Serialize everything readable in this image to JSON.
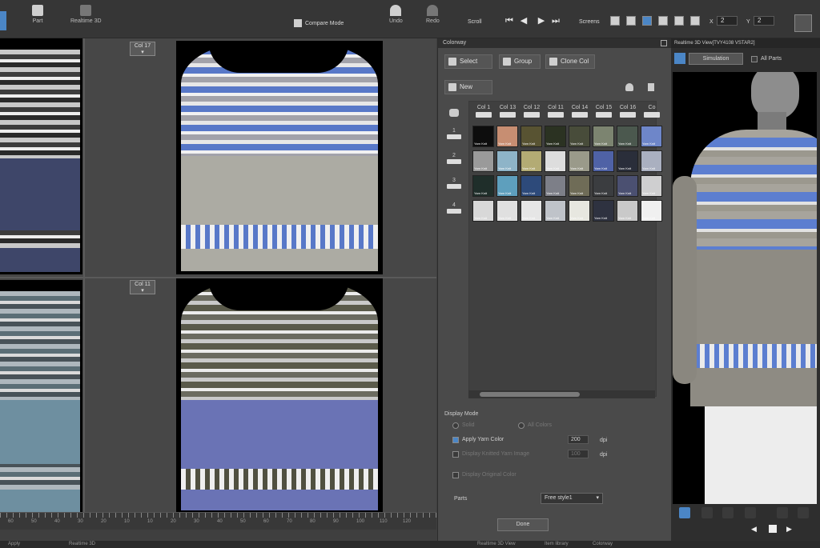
{
  "toolbar": {
    "part_label": "Part",
    "realtime_label": "Realtime 3D",
    "compare_label": "Compare Mode",
    "undo_label": "Undo",
    "redo_label": "Redo",
    "scroll_label": "Scroll",
    "screens_label": "Screens",
    "x_label": "X",
    "y_label": "Y",
    "x_value": "2",
    "y_value": "2"
  },
  "canvas": {
    "col_top": "Col 17",
    "col_bottom": "Col 11",
    "ruler_ticks": [
      "60",
      "50",
      "40",
      "30",
      "20",
      "10",
      "10",
      "20",
      "30",
      "40",
      "50",
      "60",
      "70",
      "80",
      "90",
      "100",
      "110",
      "120"
    ]
  },
  "colorway": {
    "title": "Colorway",
    "select_label": "Select",
    "group_label": "Group",
    "clone_label": "Clone Col",
    "new_label": "New",
    "columns": [
      "Col 1",
      "Col 13",
      "Col 12",
      "Col 11",
      "Col 14",
      "Col 15",
      "Col 16",
      "Co"
    ],
    "rows": [
      "1",
      "2",
      "3",
      "4"
    ],
    "cell_text": "Yarn Knit",
    "display_mode_label": "Display Mode",
    "solid_label": "Solid",
    "all_colors_label": "All Colors",
    "apply_yarn_label": "Apply Yarn Color",
    "apply_yarn_value": "200",
    "display_knitted_label": "Display Knitted Yarn Image",
    "display_knitted_value": "100",
    "dpi_label": "dpi",
    "display_original_label": "Display Original Color",
    "parts_label": "Parts",
    "parts_value": "Free style1",
    "done_label": "Done",
    "colors": [
      [
        "#0d0d0d",
        "#c78e72",
        "#585332",
        "#2b3222",
        "#484c3a",
        "#7c8470",
        "#4b584e",
        "#6e86c9"
      ],
      [
        "#9a9a9a",
        "#8eb4c8",
        "#b3ab74",
        "#dddddd",
        "#9a9a8a",
        "#4f62a6",
        "#2a2e3a",
        "#aab0c0"
      ],
      [
        "#1f2e2a",
        "#5e9fbd",
        "#2d4a7a",
        "#7d7f88",
        "#6f6c57",
        "#3b3d40",
        "#4b5071",
        "#cfcfd0"
      ],
      [
        "#d8d8d8",
        "#e0e0e0",
        "#e6e6e6",
        "#bfc3c9",
        "#e7e7e0",
        "#2e3240",
        "#c9c9c9",
        "#f0f0f0"
      ]
    ]
  },
  "view": {
    "title": "Realtime 3D View[TVY4108 VSTAR2]",
    "simulation_label": "Simulation",
    "all_parts_label": "All Parts"
  },
  "status": {
    "left_label": "Apply",
    "realtime_tab": "Realtime 3D",
    "realtime_view_tab": "Realtime 3D View",
    "item_library_tab": "Item library",
    "colorway_tab": "Colorway"
  }
}
